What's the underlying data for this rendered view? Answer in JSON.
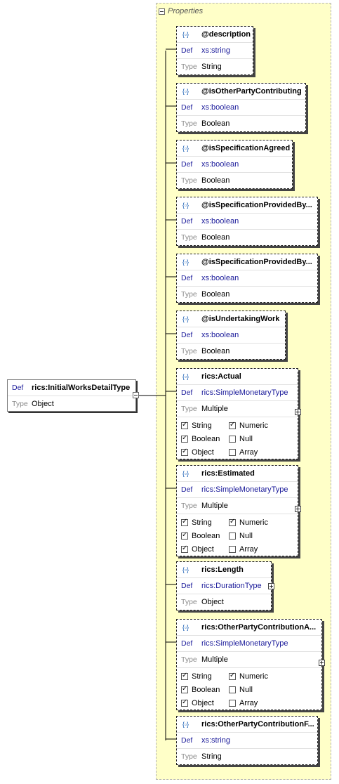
{
  "labels": {
    "def": "Def",
    "type": "Type"
  },
  "properties_panel": {
    "title": "Properties"
  },
  "root": {
    "name": "rics:InitialWorksDetailType",
    "type": "Object"
  },
  "nodes": [
    {
      "name": "@description",
      "def": "xs:string",
      "type": "String"
    },
    {
      "name": "@isOtherPartyContributing",
      "def": "xs:boolean",
      "type": "Boolean"
    },
    {
      "name": "@isSpecificationAgreed",
      "def": "xs:boolean",
      "type": "Boolean"
    },
    {
      "name": "@isSpecificationProvidedBy...",
      "def": "xs:boolean",
      "type": "Boolean"
    },
    {
      "name": "@isSpecificationProvidedBy...",
      "def": "xs:boolean",
      "type": "Boolean"
    },
    {
      "name": "@isUndertakingWork",
      "def": "xs:boolean",
      "type": "Boolean"
    },
    {
      "name": "rics:Actual",
      "def": "rics:SimpleMonetaryType",
      "type": "Multiple",
      "checks": [
        {
          "label": "String",
          "on": true
        },
        {
          "label": "Numeric",
          "on": true
        },
        {
          "label": "Boolean",
          "on": true
        },
        {
          "label": "Null",
          "on": false
        },
        {
          "label": "Object",
          "on": true
        },
        {
          "label": "Array",
          "on": false
        }
      ]
    },
    {
      "name": "rics:Estimated",
      "def": "rics:SimpleMonetaryType",
      "type": "Multiple",
      "checks": [
        {
          "label": "String",
          "on": true
        },
        {
          "label": "Numeric",
          "on": true
        },
        {
          "label": "Boolean",
          "on": true
        },
        {
          "label": "Null",
          "on": false
        },
        {
          "label": "Object",
          "on": true
        },
        {
          "label": "Array",
          "on": false
        }
      ]
    },
    {
      "name": "rics:Length",
      "def": "rics:DurationType",
      "type": "Object"
    },
    {
      "name": "rics:OtherPartyContributionA...",
      "def": "rics:SimpleMonetaryType",
      "type": "Multiple",
      "checks": [
        {
          "label": "String",
          "on": true
        },
        {
          "label": "Numeric",
          "on": true
        },
        {
          "label": "Boolean",
          "on": true
        },
        {
          "label": "Null",
          "on": false
        },
        {
          "label": "Object",
          "on": true
        },
        {
          "label": "Array",
          "on": false
        }
      ]
    },
    {
      "name": "rics:OtherPartyContributionF...",
      "def": "xs:string",
      "type": "String"
    }
  ],
  "icons": {
    "attribute": "attribute-icon",
    "element": "element-icon",
    "collapse": "collapse-icon",
    "expand": "expand-icon"
  }
}
